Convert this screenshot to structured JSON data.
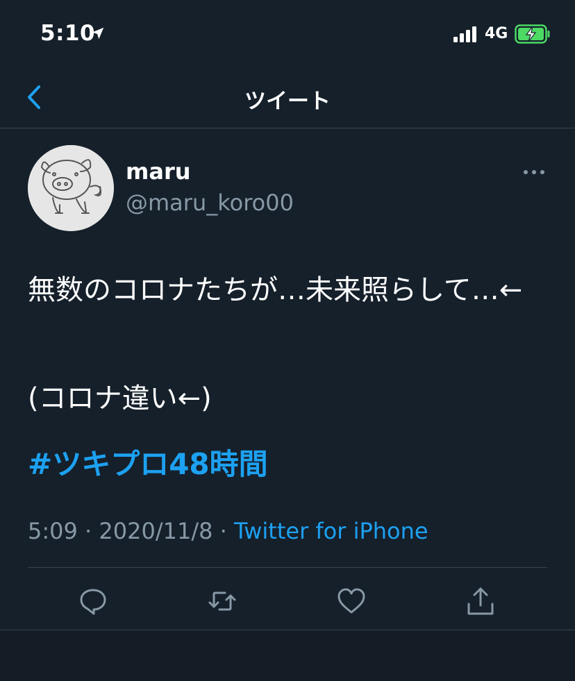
{
  "status_bar": {
    "time": "5:10",
    "network": "4G"
  },
  "nav": {
    "title": "ツイート"
  },
  "tweet": {
    "display_name": "maru",
    "username": "@maru_koro00",
    "text_line1": "無数のコロナたちが…未来照らして…←",
    "text_line2": "(コロナ違い←)",
    "hashtag": "#ツキプロ48時間",
    "time": "5:09",
    "date": "2020/11/8",
    "source": "Twitter for iPhone"
  },
  "colors": {
    "background": "#15202b",
    "accent": "#1da1f2",
    "secondary_text": "#8899a6",
    "divider": "#38444d",
    "battery": "#4cd964"
  },
  "icons": [
    "location-arrow-icon",
    "signal-icon",
    "battery-charging-icon",
    "back-chevron-icon",
    "more-icon",
    "reply-icon",
    "retweet-icon",
    "like-icon",
    "share-icon"
  ]
}
